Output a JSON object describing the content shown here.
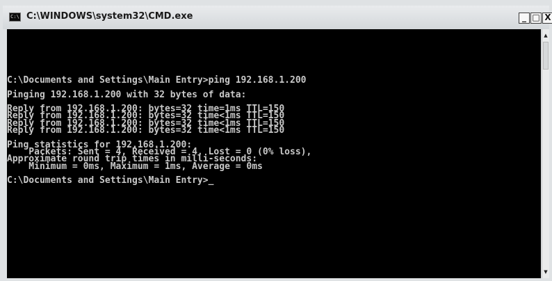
{
  "window": {
    "title": "C:\\WINDOWS\\system32\\CMD.exe",
    "icon_label": "C:\\",
    "minimize_label": "_",
    "maximize_label": "□",
    "close_label": "X"
  },
  "console": {
    "text": "C:\\Documents and Settings\\Main Entry>ping 192.168.1.200\n\nPinging 192.168.1.200 with 32 bytes of data:\n\nReply from 192.168.1.200: bytes=32 time=1ms TTL=150\nReply from 192.168.1.200: bytes=32 time<1ms TTL=150\nReply from 192.168.1.200: bytes=32 time<1ms TTL=150\nReply from 192.168.1.200: bytes=32 time<1ms TTL=150\n\nPing statistics for 192.168.1.200:\n    Packets: Sent = 4, Received = 4, Lost = 0 (0% loss),\nApproximate round trip times in milli-seconds:\n    Minimum = 0ms, Maximum = 1ms, Average = 0ms\n\nC:\\Documents and Settings\\Main Entry>",
    "cursor": "_",
    "background_color": "#000000",
    "text_color": "#c8c8c8"
  },
  "scrollbar": {
    "up_arrow": "▲",
    "down_arrow": "▼"
  }
}
